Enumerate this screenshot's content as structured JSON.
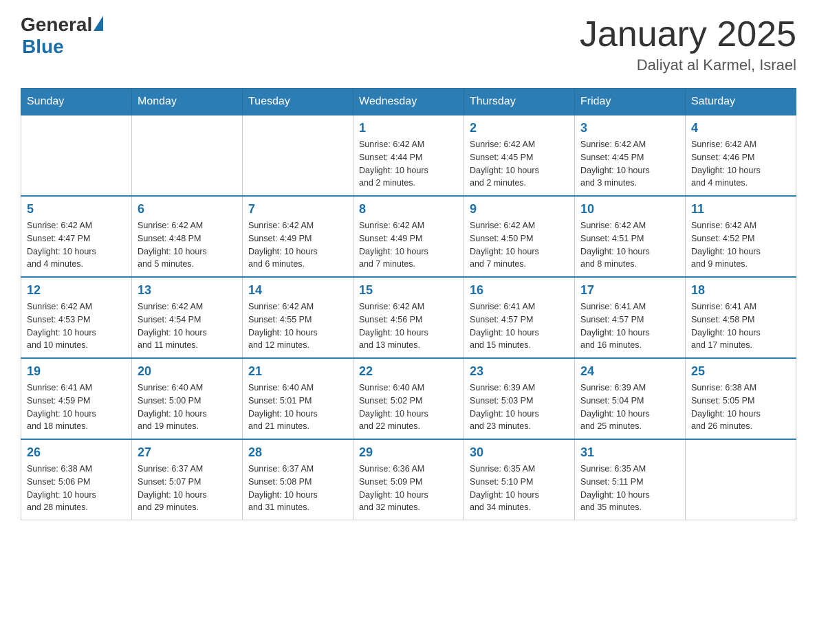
{
  "header": {
    "logo_general": "General",
    "logo_blue": "Blue",
    "month_title": "January 2025",
    "subtitle": "Daliyat al Karmel, Israel"
  },
  "days_of_week": [
    "Sunday",
    "Monday",
    "Tuesday",
    "Wednesday",
    "Thursday",
    "Friday",
    "Saturday"
  ],
  "weeks": [
    [
      {
        "day": "",
        "info": ""
      },
      {
        "day": "",
        "info": ""
      },
      {
        "day": "",
        "info": ""
      },
      {
        "day": "1",
        "info": "Sunrise: 6:42 AM\nSunset: 4:44 PM\nDaylight: 10 hours\nand 2 minutes."
      },
      {
        "day": "2",
        "info": "Sunrise: 6:42 AM\nSunset: 4:45 PM\nDaylight: 10 hours\nand 2 minutes."
      },
      {
        "day": "3",
        "info": "Sunrise: 6:42 AM\nSunset: 4:45 PM\nDaylight: 10 hours\nand 3 minutes."
      },
      {
        "day": "4",
        "info": "Sunrise: 6:42 AM\nSunset: 4:46 PM\nDaylight: 10 hours\nand 4 minutes."
      }
    ],
    [
      {
        "day": "5",
        "info": "Sunrise: 6:42 AM\nSunset: 4:47 PM\nDaylight: 10 hours\nand 4 minutes."
      },
      {
        "day": "6",
        "info": "Sunrise: 6:42 AM\nSunset: 4:48 PM\nDaylight: 10 hours\nand 5 minutes."
      },
      {
        "day": "7",
        "info": "Sunrise: 6:42 AM\nSunset: 4:49 PM\nDaylight: 10 hours\nand 6 minutes."
      },
      {
        "day": "8",
        "info": "Sunrise: 6:42 AM\nSunset: 4:49 PM\nDaylight: 10 hours\nand 7 minutes."
      },
      {
        "day": "9",
        "info": "Sunrise: 6:42 AM\nSunset: 4:50 PM\nDaylight: 10 hours\nand 7 minutes."
      },
      {
        "day": "10",
        "info": "Sunrise: 6:42 AM\nSunset: 4:51 PM\nDaylight: 10 hours\nand 8 minutes."
      },
      {
        "day": "11",
        "info": "Sunrise: 6:42 AM\nSunset: 4:52 PM\nDaylight: 10 hours\nand 9 minutes."
      }
    ],
    [
      {
        "day": "12",
        "info": "Sunrise: 6:42 AM\nSunset: 4:53 PM\nDaylight: 10 hours\nand 10 minutes."
      },
      {
        "day": "13",
        "info": "Sunrise: 6:42 AM\nSunset: 4:54 PM\nDaylight: 10 hours\nand 11 minutes."
      },
      {
        "day": "14",
        "info": "Sunrise: 6:42 AM\nSunset: 4:55 PM\nDaylight: 10 hours\nand 12 minutes."
      },
      {
        "day": "15",
        "info": "Sunrise: 6:42 AM\nSunset: 4:56 PM\nDaylight: 10 hours\nand 13 minutes."
      },
      {
        "day": "16",
        "info": "Sunrise: 6:41 AM\nSunset: 4:57 PM\nDaylight: 10 hours\nand 15 minutes."
      },
      {
        "day": "17",
        "info": "Sunrise: 6:41 AM\nSunset: 4:57 PM\nDaylight: 10 hours\nand 16 minutes."
      },
      {
        "day": "18",
        "info": "Sunrise: 6:41 AM\nSunset: 4:58 PM\nDaylight: 10 hours\nand 17 minutes."
      }
    ],
    [
      {
        "day": "19",
        "info": "Sunrise: 6:41 AM\nSunset: 4:59 PM\nDaylight: 10 hours\nand 18 minutes."
      },
      {
        "day": "20",
        "info": "Sunrise: 6:40 AM\nSunset: 5:00 PM\nDaylight: 10 hours\nand 19 minutes."
      },
      {
        "day": "21",
        "info": "Sunrise: 6:40 AM\nSunset: 5:01 PM\nDaylight: 10 hours\nand 21 minutes."
      },
      {
        "day": "22",
        "info": "Sunrise: 6:40 AM\nSunset: 5:02 PM\nDaylight: 10 hours\nand 22 minutes."
      },
      {
        "day": "23",
        "info": "Sunrise: 6:39 AM\nSunset: 5:03 PM\nDaylight: 10 hours\nand 23 minutes."
      },
      {
        "day": "24",
        "info": "Sunrise: 6:39 AM\nSunset: 5:04 PM\nDaylight: 10 hours\nand 25 minutes."
      },
      {
        "day": "25",
        "info": "Sunrise: 6:38 AM\nSunset: 5:05 PM\nDaylight: 10 hours\nand 26 minutes."
      }
    ],
    [
      {
        "day": "26",
        "info": "Sunrise: 6:38 AM\nSunset: 5:06 PM\nDaylight: 10 hours\nand 28 minutes."
      },
      {
        "day": "27",
        "info": "Sunrise: 6:37 AM\nSunset: 5:07 PM\nDaylight: 10 hours\nand 29 minutes."
      },
      {
        "day": "28",
        "info": "Sunrise: 6:37 AM\nSunset: 5:08 PM\nDaylight: 10 hours\nand 31 minutes."
      },
      {
        "day": "29",
        "info": "Sunrise: 6:36 AM\nSunset: 5:09 PM\nDaylight: 10 hours\nand 32 minutes."
      },
      {
        "day": "30",
        "info": "Sunrise: 6:35 AM\nSunset: 5:10 PM\nDaylight: 10 hours\nand 34 minutes."
      },
      {
        "day": "31",
        "info": "Sunrise: 6:35 AM\nSunset: 5:11 PM\nDaylight: 10 hours\nand 35 minutes."
      },
      {
        "day": "",
        "info": ""
      }
    ]
  ]
}
